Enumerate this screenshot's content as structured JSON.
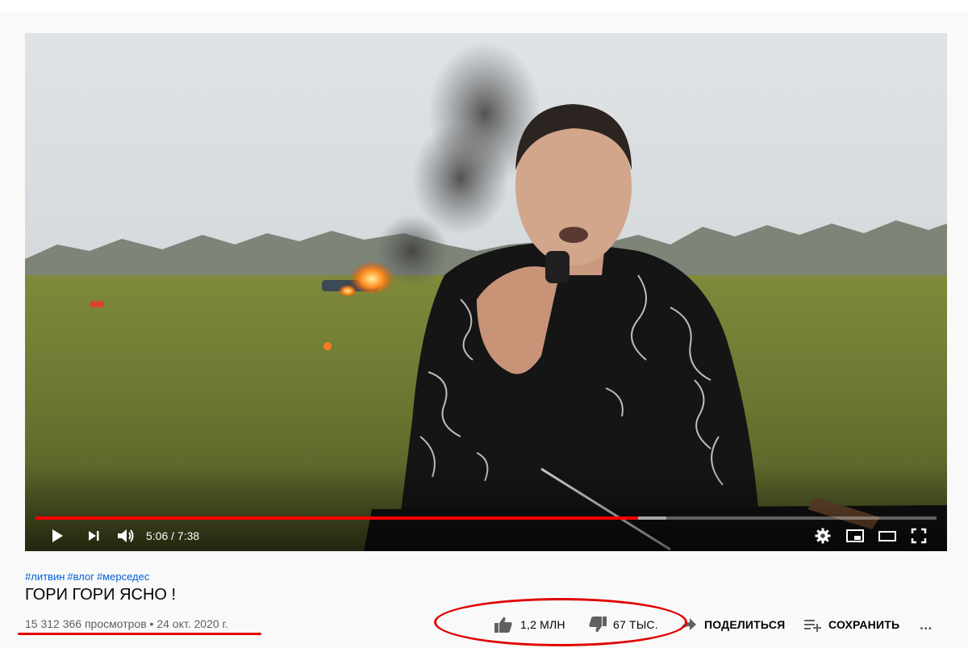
{
  "video": {
    "current_time": "5:06",
    "duration": "7:38",
    "time_separator": "/",
    "progress_fraction": 0.669,
    "buffered_fraction": 0.7
  },
  "player_controls": {
    "play_icon": "play-icon",
    "next_icon": "next-icon",
    "volume_icon": "volume-icon",
    "settings_icon": "gear-icon",
    "miniplayer_icon": "miniplayer-icon",
    "theater_icon": "theater-mode-icon",
    "fullscreen_icon": "fullscreen-icon"
  },
  "info": {
    "hashtags": [
      "#литвин",
      "#влог",
      "#мерседес"
    ],
    "title": "ГОРИ ГОРИ ЯСНО !",
    "views": "15 312 366 просмотров",
    "bullet": "•",
    "date": "24 окт. 2020 г."
  },
  "actions": {
    "like_count": "1,2 МЛН",
    "dislike_count": "67 ТЫС.",
    "share_label": "ПОДЕЛИТЬСЯ",
    "save_label": "СОХРАНИТЬ",
    "more_label": "..."
  },
  "colors": {
    "progress": "#ff0000",
    "annotation": "#e00000",
    "hashtag": "#065fd4",
    "text": "#030303",
    "secondary_text": "#606060"
  }
}
